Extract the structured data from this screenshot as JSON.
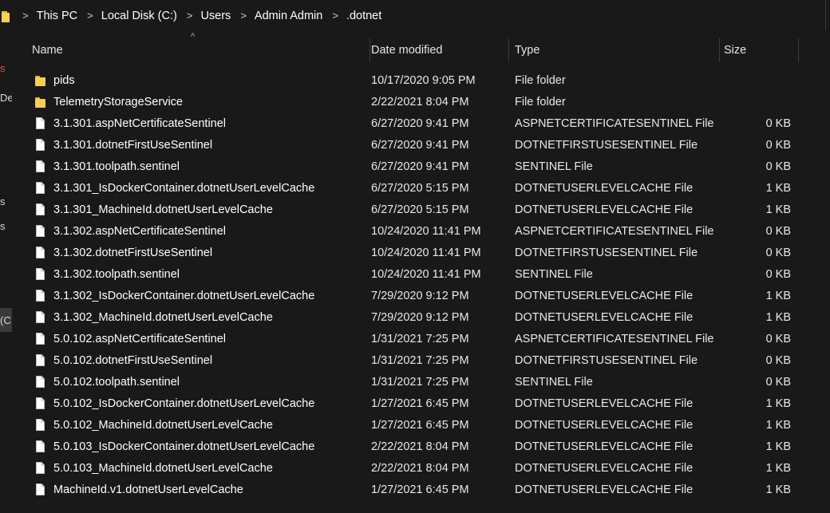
{
  "address_bar": {
    "crumbs": [
      "This PC",
      "Local Disk (C:)",
      "Users",
      "Admin Admin",
      ".dotnet"
    ],
    "separator": ">"
  },
  "nav_pane": {
    "fragments": [
      "s",
      "Der",
      "s",
      "s",
      "(C"
    ]
  },
  "columns": {
    "name": "Name",
    "date_modified": "Date modified",
    "type": "Type",
    "size": "Size",
    "sort_indicator": "^"
  },
  "files": [
    {
      "icon": "folder-icon",
      "name": "pids",
      "date": "10/17/2020 9:05 PM",
      "type": "File folder",
      "size": ""
    },
    {
      "icon": "folder-icon",
      "name": "TelemetryStorageService",
      "date": "2/22/2021 8:04 PM",
      "type": "File folder",
      "size": ""
    },
    {
      "icon": "file-icon",
      "name": "3.1.301.aspNetCertificateSentinel",
      "date": "6/27/2020 9:41 PM",
      "type": "ASPNETCERTIFICATESENTINEL File",
      "size": "0 KB"
    },
    {
      "icon": "file-icon",
      "name": "3.1.301.dotnetFirstUseSentinel",
      "date": "6/27/2020 9:41 PM",
      "type": "DOTNETFIRSTUSESENTINEL File",
      "size": "0 KB"
    },
    {
      "icon": "file-icon",
      "name": "3.1.301.toolpath.sentinel",
      "date": "6/27/2020 9:41 PM",
      "type": "SENTINEL File",
      "size": "0 KB"
    },
    {
      "icon": "file-icon",
      "name": "3.1.301_IsDockerContainer.dotnetUserLevelCache",
      "date": "6/27/2020 5:15 PM",
      "type": "DOTNETUSERLEVELCACHE File",
      "size": "1 KB"
    },
    {
      "icon": "file-icon",
      "name": "3.1.301_MachineId.dotnetUserLevelCache",
      "date": "6/27/2020 5:15 PM",
      "type": "DOTNETUSERLEVELCACHE File",
      "size": "1 KB"
    },
    {
      "icon": "file-icon",
      "name": "3.1.302.aspNetCertificateSentinel",
      "date": "10/24/2020 11:41 PM",
      "type": "ASPNETCERTIFICATESENTINEL File",
      "size": "0 KB"
    },
    {
      "icon": "file-icon",
      "name": "3.1.302.dotnetFirstUseSentinel",
      "date": "10/24/2020 11:41 PM",
      "type": "DOTNETFIRSTUSESENTINEL File",
      "size": "0 KB"
    },
    {
      "icon": "file-icon",
      "name": "3.1.302.toolpath.sentinel",
      "date": "10/24/2020 11:41 PM",
      "type": "SENTINEL File",
      "size": "0 KB"
    },
    {
      "icon": "file-icon",
      "name": "3.1.302_IsDockerContainer.dotnetUserLevelCache",
      "date": "7/29/2020 9:12 PM",
      "type": "DOTNETUSERLEVELCACHE File",
      "size": "1 KB"
    },
    {
      "icon": "file-icon",
      "name": "3.1.302_MachineId.dotnetUserLevelCache",
      "date": "7/29/2020 9:12 PM",
      "type": "DOTNETUSERLEVELCACHE File",
      "size": "1 KB"
    },
    {
      "icon": "file-icon",
      "name": "5.0.102.aspNetCertificateSentinel",
      "date": "1/31/2021 7:25 PM",
      "type": "ASPNETCERTIFICATESENTINEL File",
      "size": "0 KB"
    },
    {
      "icon": "file-icon",
      "name": "5.0.102.dotnetFirstUseSentinel",
      "date": "1/31/2021 7:25 PM",
      "type": "DOTNETFIRSTUSESENTINEL File",
      "size": "0 KB"
    },
    {
      "icon": "file-icon",
      "name": "5.0.102.toolpath.sentinel",
      "date": "1/31/2021 7:25 PM",
      "type": "SENTINEL File",
      "size": "0 KB"
    },
    {
      "icon": "file-icon",
      "name": "5.0.102_IsDockerContainer.dotnetUserLevelCache",
      "date": "1/27/2021 6:45 PM",
      "type": "DOTNETUSERLEVELCACHE File",
      "size": "1 KB"
    },
    {
      "icon": "file-icon",
      "name": "5.0.102_MachineId.dotnetUserLevelCache",
      "date": "1/27/2021 6:45 PM",
      "type": "DOTNETUSERLEVELCACHE File",
      "size": "1 KB"
    },
    {
      "icon": "file-icon",
      "name": "5.0.103_IsDockerContainer.dotnetUserLevelCache",
      "date": "2/22/2021 8:04 PM",
      "type": "DOTNETUSERLEVELCACHE File",
      "size": "1 KB"
    },
    {
      "icon": "file-icon",
      "name": "5.0.103_MachineId.dotnetUserLevelCache",
      "date": "2/22/2021 8:04 PM",
      "type": "DOTNETUSERLEVELCACHE File",
      "size": "1 KB"
    },
    {
      "icon": "file-icon",
      "name": "MachineId.v1.dotnetUserLevelCache",
      "date": "1/27/2021 6:45 PM",
      "type": "DOTNETUSERLEVELCACHE File",
      "size": "1 KB"
    }
  ],
  "colors": {
    "background": "#191919",
    "text": "#ffffff",
    "folder": "#f6cf55",
    "selection": "#3a3a3a"
  }
}
